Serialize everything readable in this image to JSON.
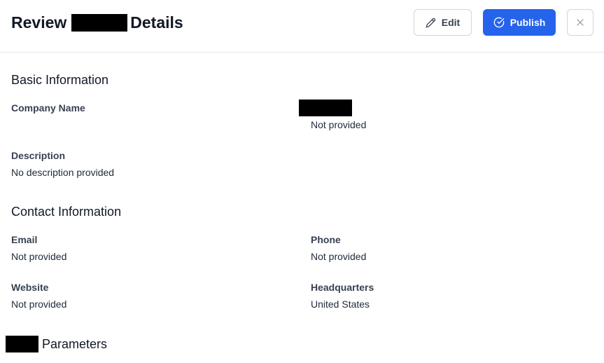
{
  "header": {
    "title_prefix": "Review",
    "title_suffix": "Details",
    "edit_label": "Edit",
    "publish_label": "Publish",
    "close_icon": "close-icon",
    "edit_icon": "pencil-icon",
    "publish_icon": "check-circle-icon",
    "publish_color": "#2563eb"
  },
  "basic_info": {
    "heading": "Basic Information",
    "company_name_label": "Company Name",
    "company_name_value": "Not provided",
    "description_label": "Description",
    "description_value": "No description provided"
  },
  "contact_info": {
    "heading": "Contact Information",
    "email_label": "Email",
    "email_value": "Not provided",
    "phone_label": "Phone",
    "phone_value": "Not provided",
    "website_label": "Website",
    "website_value": "Not provided",
    "headquarters_label": "Headquarters",
    "headquarters_value": "United States"
  },
  "parameters": {
    "heading_suffix": "Parameters"
  }
}
